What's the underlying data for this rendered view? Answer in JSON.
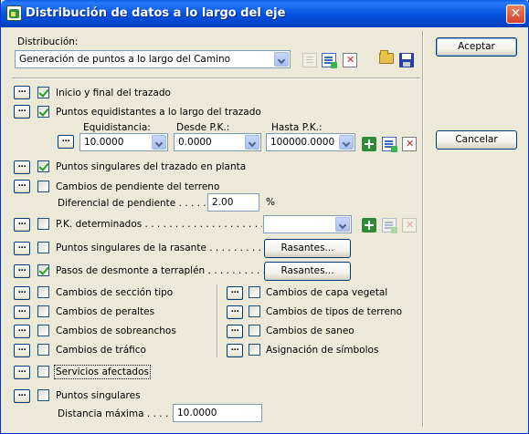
{
  "window": {
    "title": "Distribución de datos a lo largo del eje",
    "close_glyph": "✕"
  },
  "distribucion": {
    "label": "Distribución:",
    "selected": "Generación de puntos a lo largo del Camino"
  },
  "buttons": {
    "aceptar": "Aceptar",
    "cancelar": "Cancelar",
    "dots": "...",
    "rasantes_1": "Rasantes...",
    "rasantes_2": "Rasantes..."
  },
  "rows": {
    "inicio_final": {
      "label": "Inicio y final del trazado",
      "checked": true
    },
    "equidistantes": {
      "label": "Puntos equidistantes a lo largo del trazado",
      "checked": true
    },
    "singulares_planta": {
      "label": "Puntos singulares del trazado en planta",
      "checked": true
    },
    "cambios_pendiente": {
      "label": "Cambios de pendiente del terreno",
      "checked": false
    },
    "pk_determinados": {
      "label": "P.K. determinados . . . . . . . . . . . . . . . . . . . . . . .",
      "checked": false
    },
    "singulares_rasante": {
      "label": "Puntos singulares de la rasante . . . . . . . . . .",
      "checked": false
    },
    "desmonte_terraplen": {
      "label": "Pasos de desmonte a terraplén . . . . . . . . . .",
      "checked": true
    },
    "cambios_seccion": {
      "label": "Cambios de sección tipo",
      "checked": false
    },
    "cambios_peraltes": {
      "label": "Cambios de peraltes",
      "checked": false
    },
    "cambios_sobreanchos": {
      "label": "Cambios de sobreanchos",
      "checked": false
    },
    "cambios_trafico": {
      "label": "Cambios de tráfico",
      "checked": false
    },
    "cambios_capa_vegetal": {
      "label": "Cambios de capa vegetal",
      "checked": false
    },
    "cambios_tipos_terreno": {
      "label": "Cambios de tipos de terreno",
      "checked": false
    },
    "cambios_saneo": {
      "label": "Cambios de saneo",
      "checked": false
    },
    "asignacion_simbolos": {
      "label": "Asignación de símbolos",
      "checked": false
    },
    "servicios_afectados": {
      "label": "Servicios afectados",
      "checked": false
    },
    "puntos_singulares": {
      "label": "Puntos singulares",
      "checked": false
    }
  },
  "equidistancia": {
    "label": "Equidistancia:",
    "value": "10.0000",
    "desde_label": "Desde P.K.:",
    "desde_value": "0.0000",
    "hasta_label": "Hasta P.K.:",
    "hasta_value": "100000.0000"
  },
  "pendiente": {
    "label": "Diferencial de pendiente . . . . . .",
    "value": "2.00",
    "unit": "%"
  },
  "pk": {
    "selected": ""
  },
  "distancia": {
    "label": "Distancia máxima . . . . .",
    "value": "10.0000"
  }
}
